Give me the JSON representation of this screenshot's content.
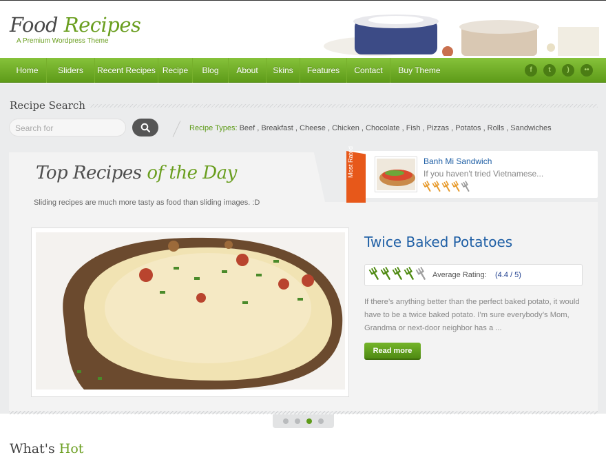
{
  "header": {
    "logo_word1": "Food",
    "logo_word2": "Recipes",
    "tagline": "A Premium Wordpress Theme"
  },
  "nav": {
    "items": [
      "Home",
      "Sliders",
      "Recent Recipes",
      "Recipe",
      "Blog",
      "About",
      "Skins",
      "Features",
      "Contact",
      "Buy Theme"
    ]
  },
  "social": {
    "icons": [
      "facebook-icon",
      "twitter-icon",
      "rss-icon",
      "flickr-icon"
    ],
    "glyphs": [
      "f",
      "t",
      ")",
      "••"
    ]
  },
  "search": {
    "title": "Recipe Search",
    "placeholder": "Search for",
    "types_label": "Recipe Types:",
    "types_list": " Beef , Breakfast , Cheese , Chicken , Chocolate , Fish , Pizzas , Potatos , Rolls , Sandwiches"
  },
  "top_recipes": {
    "title_a": "Top Recipes ",
    "title_b": "of the Day",
    "subtitle": "Sliding recipes are much more tasty as food than sliding images. :D"
  },
  "most_rated": {
    "ribbon": "Most Rated",
    "name": "Banh Mi Sandwich",
    "desc": "If you haven't tried Vietnamese...",
    "rating": 4,
    "max": 5
  },
  "featured": {
    "title": "Twice Baked Potatoes",
    "rating_label": "Average Rating:",
    "rating_value": "(4.4 / 5)",
    "rating": 4,
    "max": 5,
    "description": "If there’s anything better than the perfect baked potato, it would have to be a twice baked potato. I’m sure everybody’s Mom, Grandma or next-door neighbor has a ...",
    "read_more": "Read more"
  },
  "pager": {
    "count": 4,
    "active": 3
  },
  "whats_hot": {
    "title_a": "What's ",
    "title_b": "Hot"
  },
  "colors": {
    "accent": "#6a9e1f",
    "link": "#1f5fa5",
    "ribbon": "#e7581a"
  }
}
